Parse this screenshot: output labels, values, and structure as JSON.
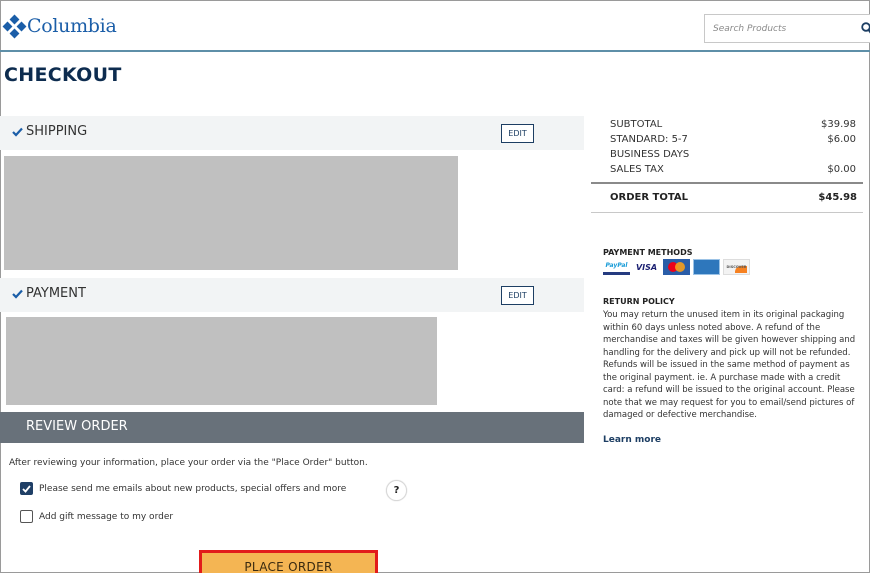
{
  "header": {
    "logo_text": "Columbia",
    "search_placeholder": "Search Products"
  },
  "page": {
    "title": "CHECKOUT"
  },
  "shipping": {
    "title": "SHIPPING",
    "edit_label": "EDIT"
  },
  "payment": {
    "title": "PAYMENT",
    "edit_label": "EDIT"
  },
  "review": {
    "title": "REVIEW ORDER",
    "note": "After reviewing your information, place your order via the \"Place Order\" button.",
    "email_optin_label": "Please send me emails about new products, special offers and more",
    "email_optin_checked": true,
    "gift_message_label": "Add gift message to my order",
    "gift_message_checked": false,
    "help_label": "?",
    "place_order_label": "PLACE ORDER"
  },
  "summary": {
    "subtotal_label": "SUBTOTAL",
    "subtotal_value": "$39.98",
    "shipping_label_1": "STANDARD: 5-7",
    "shipping_label_2": "BUSINESS DAYS",
    "shipping_value": "$6.00",
    "tax_label": "SALES TAX",
    "tax_value": "$0.00",
    "total_label": "ORDER TOTAL",
    "total_value": "$45.98"
  },
  "payment_methods": {
    "title": "PAYMENT METHODS",
    "cards": [
      "PayPal",
      "VISA",
      "MasterCard",
      "American Express",
      "DISCOVER"
    ]
  },
  "return_policy": {
    "title": "RETURN POLICY",
    "text": "You may return the unused item in its original packaging within 60 days unless noted above. A refund of the merchandise and taxes will be given however shipping and handling for the delivery and pick up will not be refunded. Refunds will be issued in the same method of payment as the original payment. ie. A purchase made with a credit card: a refund will be issued to the original account. Please note that we may request for you to email/send pictures of damaged or defective merchandise.",
    "learn_more": "Learn more"
  },
  "colors": {
    "brand_blue": "#1b5ea8",
    "navy": "#0d2c4f",
    "review_bar": "#68717a",
    "place_order_bg": "#f4b553",
    "highlight_border": "#e21b1b"
  }
}
